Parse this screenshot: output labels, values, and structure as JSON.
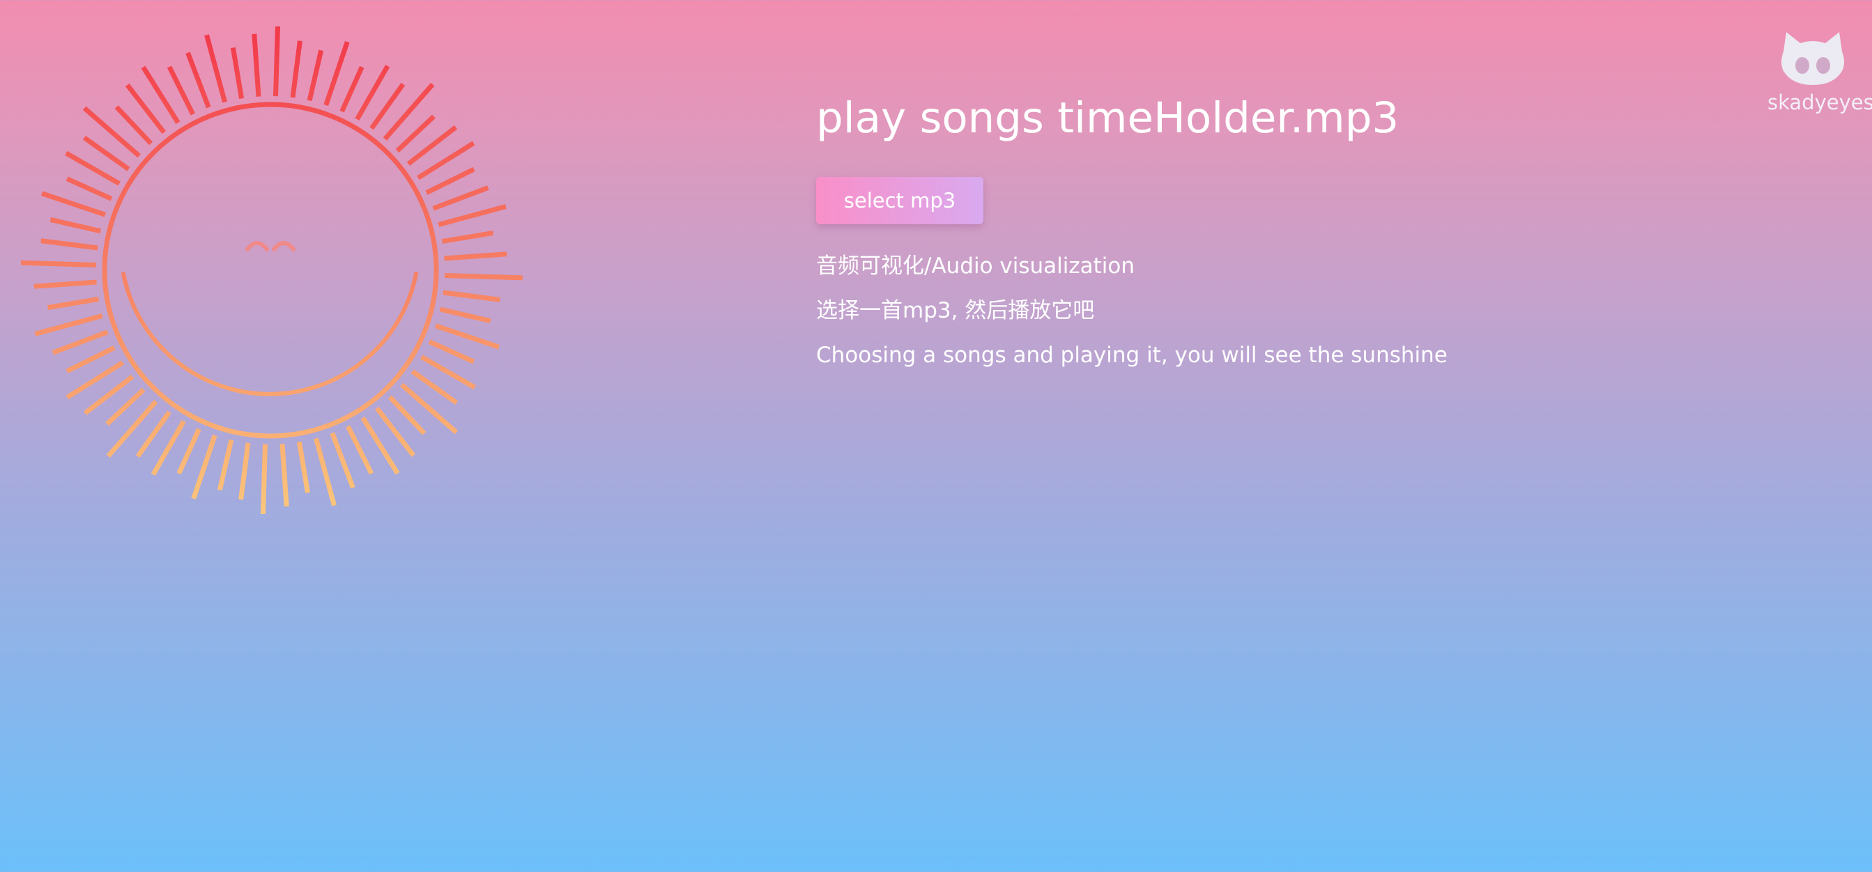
{
  "player": {
    "title": "play songs timeHolder.mp3",
    "select_label": "select mp3"
  },
  "description": {
    "line1": "音频可视化/Audio visualization",
    "line2": "选择一首mp3, 然后播放它吧",
    "line3": "Choosing a songs and playing it, you will see the sunshine"
  },
  "github": {
    "username": "skadyeyes",
    "icon": "github-octocat-icon"
  },
  "visualizer": {
    "icon": "sun-visualizer",
    "ray_count": 64,
    "colors": {
      "top": "#f2384a",
      "bottom": "#fbc77c"
    }
  },
  "colors": {
    "background_top": "#f28db0",
    "background_bottom": "#6cc0fa",
    "button_start": "#f98fc8",
    "button_end": "#d9a9ef",
    "text": "#ffffff"
  }
}
